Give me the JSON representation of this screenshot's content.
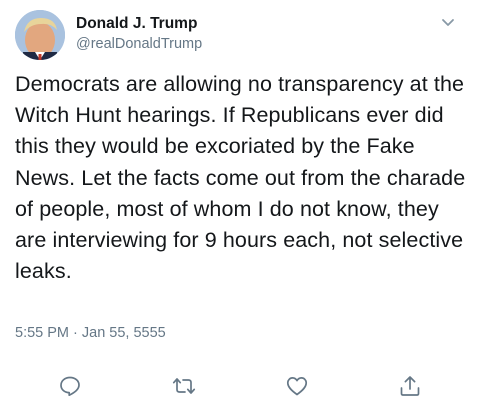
{
  "tweet": {
    "author_name": "Donald J. Trump",
    "author_handle": "@realDonaldTrump",
    "text": "Democrats are allowing no transparency at the Witch Hunt hearings. If Republicans ever did this they would be excoriated by the Fake News. Let the facts come out from the charade of people, most of whom I do not know, they are interviewing for 9 hours each, not selective leaks.",
    "timestamp": "5:55 PM · Jan 55, 5555"
  },
  "icons": {
    "menu": "chevron-down-icon",
    "reply": "comment-icon",
    "retweet": "retweet-icon",
    "like": "heart-icon",
    "share": "share-icon"
  },
  "colors": {
    "name": "#14171a",
    "secondary": "#657786"
  }
}
